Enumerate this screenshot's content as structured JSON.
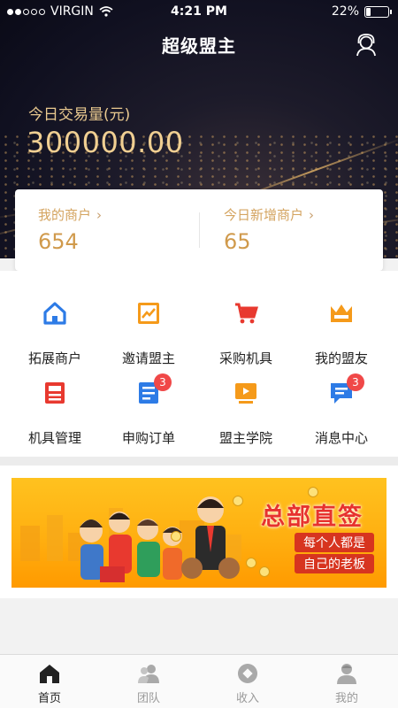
{
  "status_bar": {
    "carrier": "VIRGIN",
    "time": "4:21 PM",
    "battery": "22%",
    "battery_level": 0.22
  },
  "header": {
    "title": "超级盟主",
    "service_icon": "customer-service-icon"
  },
  "transactions": {
    "label": "今日交易量(元)",
    "value": "300000.00"
  },
  "stats": {
    "my_merchants_label": "我的商户",
    "my_merchants_value": "654",
    "new_merchants_label": "今日新增商户",
    "new_merchants_value": "65",
    "chevron": "›"
  },
  "grid": {
    "items": [
      {
        "label": "拓展商户",
        "icon": "house-icon"
      },
      {
        "label": "邀请盟主",
        "icon": "trend-icon"
      },
      {
        "label": "采购机具",
        "icon": "cart-icon"
      },
      {
        "label": "我的盟友",
        "icon": "crown-icon"
      },
      {
        "label": "机具管理",
        "icon": "device-icon"
      },
      {
        "label": "申购订单",
        "icon": "order-icon",
        "badge": "3"
      },
      {
        "label": "盟主学院",
        "icon": "video-icon"
      },
      {
        "label": "消息中心",
        "icon": "message-icon",
        "badge": "3"
      }
    ]
  },
  "banner": {
    "title": "总部直签",
    "line1": "每个人都是",
    "line2": "自己的老板"
  },
  "tabs": [
    {
      "label": "首页",
      "icon": "home-icon",
      "active": true
    },
    {
      "label": "团队",
      "icon": "team-icon",
      "active": false
    },
    {
      "label": "收入",
      "icon": "income-icon",
      "active": false
    },
    {
      "label": "我的",
      "icon": "profile-icon",
      "active": false
    }
  ],
  "colors": {
    "gold": "#d09a4c",
    "blue": "#2d7be6",
    "orange": "#f59a1a",
    "red": "#e8392f",
    "badge": "#f04848"
  }
}
